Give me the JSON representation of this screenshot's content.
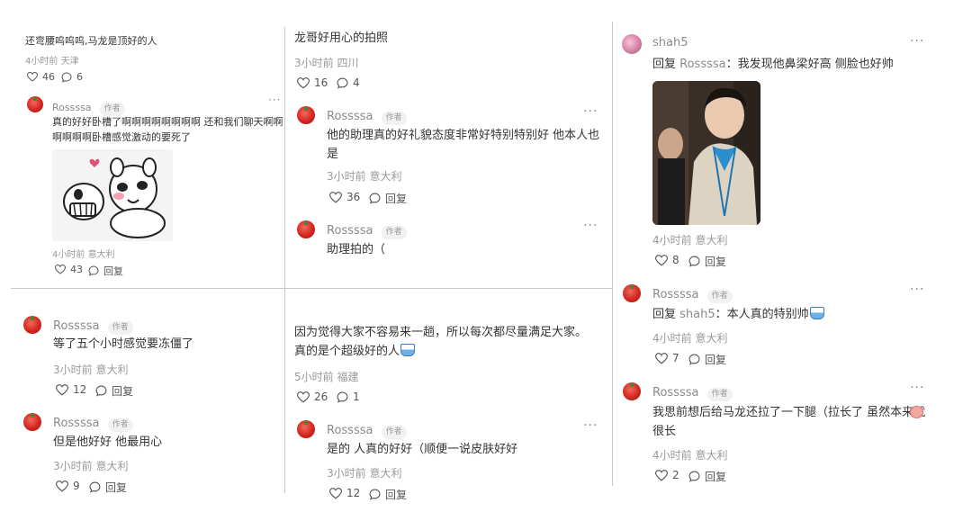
{
  "col1": {
    "c1": {
      "text": "还弯腰呜呜呜,马龙是顶好的人",
      "time": "4小时前",
      "loc": "天津",
      "likes": "46",
      "comments": "6"
    },
    "r1": {
      "user": "Rossssa",
      "badge": "作者",
      "text": "真的好好卧槽了啊啊啊啊啊啊啊啊 还和我们聊天啊啊啊啊啊啊卧槽感觉激动的要死了",
      "time": "4小时前",
      "loc": "意大利",
      "likes": "43",
      "reply": "回复"
    },
    "r2": {
      "user": "Rossssa",
      "badge": "作者",
      "text": "等了五个小时感觉要冻僵了",
      "time": "3小时前",
      "loc": "意大利",
      "likes": "12",
      "reply": "回复"
    },
    "r3": {
      "user": "Rossssa",
      "badge": "作者",
      "text": "但是他好好 他最用心",
      "time": "3小时前",
      "loc": "意大利",
      "likes": "9",
      "reply": "回复"
    }
  },
  "col2": {
    "c1": {
      "text": "龙哥好用心的拍照",
      "time": "3小时前",
      "loc": "四川",
      "likes": "16",
      "comments": "4"
    },
    "r1": {
      "user": "Rossssa",
      "badge": "作者",
      "text": "他的助理真的好礼貌态度非常好特别特别好 他本人也是",
      "time": "3小时前",
      "loc": "意大利",
      "likes": "36",
      "reply": "回复"
    },
    "r2": {
      "user": "Rossssa",
      "badge": "作者",
      "text": "助理拍的（"
    },
    "c2": {
      "text": "因为觉得大家不容易来一趟，所以每次都尽量满足大家。真的是个超级好的人",
      "time": "5小时前",
      "loc": "福建",
      "likes": "26",
      "comments": "1"
    },
    "r3": {
      "user": "Rossssa",
      "badge": "作者",
      "text": "是的 人真的好好（顺便一说皮肤好好",
      "time": "3小时前",
      "loc": "意大利",
      "likes": "12",
      "reply": "回复"
    }
  },
  "col3": {
    "r1": {
      "user": "shah5",
      "reply_prefix": "回复",
      "reply_to": "Rossssa",
      "text": "：我发现他鼻梁好高 侧脸也好帅",
      "time": "4小时前",
      "loc": "意大利",
      "likes": "8",
      "reply": "回复"
    },
    "r2": {
      "user": "Rossssa",
      "badge": "作者",
      "reply_prefix": "回复",
      "reply_to": "shah5",
      "text": "：本人真的特别帅",
      "time": "4小时前",
      "loc": "意大利",
      "likes": "7",
      "reply": "回复"
    },
    "r3": {
      "user": "Rossssa",
      "badge": "作者",
      "text": "我思前想后给马龙还拉了一下腿（拉长了 虽然本来就很长",
      "time": "4小时前",
      "loc": "意大利",
      "likes": "2",
      "reply": "回复"
    }
  },
  "icons": {
    "like": "heart-outline-icon",
    "comment": "speech-bubble-icon",
    "more": "ellipsis-icon"
  }
}
